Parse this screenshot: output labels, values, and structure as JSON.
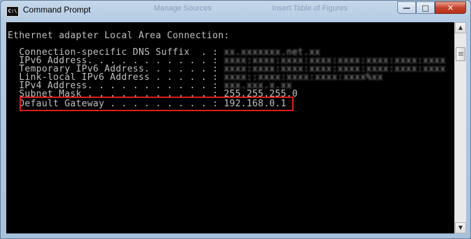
{
  "window": {
    "title": "Command Prompt",
    "icon_label": "C:\\",
    "background_tabs": [
      "Manage Sources",
      "Insert Table of Figures"
    ]
  },
  "controls": {
    "minimize": "—",
    "maximize": "□",
    "close": "✕"
  },
  "console": {
    "header": "Ethernet adapter Local Area Connection:",
    "rows": [
      {
        "label": "Connection-specific DNS Suffix  . :",
        "value": "xx.xxxxxxx.net.xx",
        "obscured": true
      },
      {
        "label": "IPv6 Address. . . . . . . . . . . :",
        "value": "xxxx:xxxx:xxxx:xxxx:xxxx:xxxx:xxxx:xxxx",
        "obscured": true
      },
      {
        "label": "Temporary IPv6 Address. . . . . . :",
        "value": "xxxx:xxxx:xxxx:xxxx:xxxx:xxxx:xxxx:xxxx",
        "obscured": true
      },
      {
        "label": "Link-local IPv6 Address . . . . . :",
        "value": "xxxx::xxxx:xxxx:xxxx:xxxx%xx",
        "obscured": true
      },
      {
        "label": "IPv4 Address. . . . . . . . . . . :",
        "value": "xxx.xxx.x.xx",
        "obscured": true
      },
      {
        "label": "Subnet Mask . . . . . . . . . . . :",
        "value": "255.255.255.0",
        "obscured": false
      },
      {
        "label": "Default Gateway . . . . . . . . . :",
        "value": "192.168.0.1",
        "obscured": false
      }
    ]
  },
  "scrollbar": {
    "up": "▲",
    "down": "▼"
  }
}
